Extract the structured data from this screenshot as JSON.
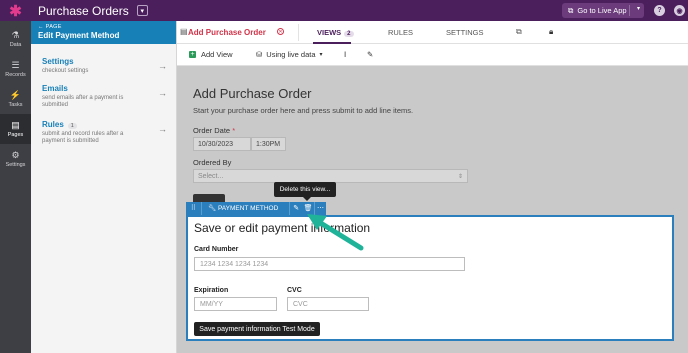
{
  "app": {
    "title": "Purchase Orders"
  },
  "topbar": {
    "go_live": "Go to Live App",
    "help_icon": "?",
    "account_icon": "◉"
  },
  "rail": [
    {
      "label": "Data",
      "icon": "⚗"
    },
    {
      "label": "Records",
      "icon": "☰"
    },
    {
      "label": "Tasks",
      "icon": "⚡"
    },
    {
      "label": "Pages",
      "icon": "▤"
    },
    {
      "label": "Settings",
      "icon": "⚙"
    }
  ],
  "panel": {
    "back": "← PAGE",
    "title": "Edit Payment Method",
    "items": [
      {
        "title": "Settings",
        "subtitle": "checkout settings",
        "badge": ""
      },
      {
        "title": "Emails",
        "subtitle": "send emails after a payment is submitted",
        "badge": ""
      },
      {
        "title": "Rules",
        "subtitle": "submit and record rules after a payment is submitted",
        "badge": "1"
      }
    ]
  },
  "header": {
    "view_name": "Add Purchase Order",
    "tabs": [
      {
        "label": "VIEWS",
        "badge": "2"
      },
      {
        "label": "RULES",
        "badge": ""
      },
      {
        "label": "SETTINGS",
        "badge": ""
      }
    ]
  },
  "toolbar": {
    "add_view": "Add View",
    "data_source": "Using live data"
  },
  "form": {
    "title": "Add Purchase Order",
    "subtitle": "Start your purchase order here and press submit to add line items.",
    "order_date_label": "Order Date",
    "required_mark": "*",
    "date_value": "10/30/2023",
    "time_value": "1:30PM",
    "ordered_by_label": "Ordered By",
    "ordered_by_placeholder": "Select..."
  },
  "tooltip": "Delete this view...",
  "view_toolbar": {
    "name": "PAYMENT METHOD"
  },
  "payment": {
    "title": "Save or edit payment information",
    "card_label": "Card Number",
    "card_placeholder": "1234 1234 1234 1234",
    "exp_label": "Expiration",
    "exp_placeholder": "MM/YY",
    "cvc_label": "CVC",
    "cvc_placeholder": "CVC",
    "button": "Save payment information Test Mode"
  },
  "colors": {
    "brand": "#4b1f5c",
    "accent": "#1780b7",
    "view_blue": "#2c7fbd",
    "arrow": "#1fb39a"
  }
}
